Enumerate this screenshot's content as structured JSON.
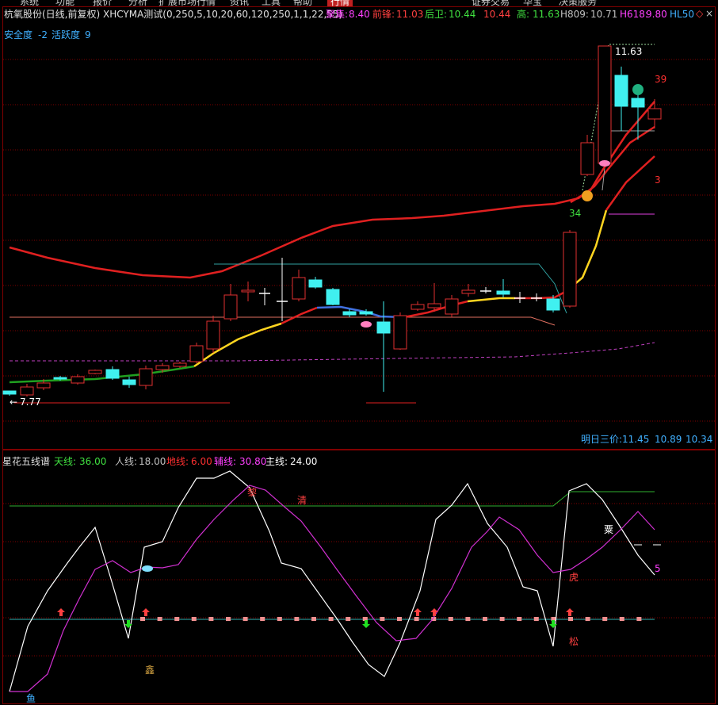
{
  "menu": [
    "系统",
    "功能",
    "报价",
    "分析",
    "扩展市场行情",
    "资讯",
    "工具",
    "帮助",
    "行情",
    "证券交易",
    "华宝",
    "决策服务"
  ],
  "main": {
    "title": "杭氧股份(日线,前复权) XHCYMA测试(0,250,5,10,20,60,120,250,1,1,22,55)",
    "juji_label": "聚集:",
    "juji_value": "8.40",
    "qianfeng_label": "前锋:",
    "qianfeng_value": "11.03",
    "houwei_label": "后卫:",
    "houwei_value": "10.44",
    "extra_value": "10.44",
    "high_label": "高:",
    "high_value": "11.63",
    "h809_label": "H809:",
    "h809_value": "10.71",
    "h618_label": "H618:",
    "h618_value": "9.80",
    "hl_label": "HL50",
    "safety_label": "安全度",
    "safety_value": "-2",
    "activity_label": "活跃度",
    "activity_value": "9",
    "price_high": "11.63",
    "price_low": "7.77",
    "label_39": "39",
    "label_3": "3",
    "label_34": "34",
    "tomorrow_label": "明日三价:",
    "tomorrow_v1": "11.45",
    "tomorrow_v2": "10.89",
    "tomorrow_v3": "10.34"
  },
  "sub": {
    "title": "星花五线谱",
    "tian_label": "天线:",
    "tian_value": "36.00",
    "ren_label": "人线:",
    "ren_value": "18.00",
    "di_label": "地线:",
    "di_value": "6.00",
    "fu_label": "辅线:",
    "fu_value": "30.80",
    "zhu_label": "主线:",
    "zhu_value": "24.00",
    "mk_li": "黎",
    "mk_qing": "清",
    "mk_su": "粟",
    "mk_xin": "鑫",
    "mk_yu": "鱼",
    "mk_hu": "虎",
    "mk_song": "松",
    "mk_5": "5"
  },
  "colors": {
    "red": "#e0201e",
    "yellow": "#ffd520",
    "green": "#20a020",
    "cyan": "#40f0f0",
    "magenta": "#e040e0",
    "grid": "#800000",
    "white": "#ffffff"
  }
}
